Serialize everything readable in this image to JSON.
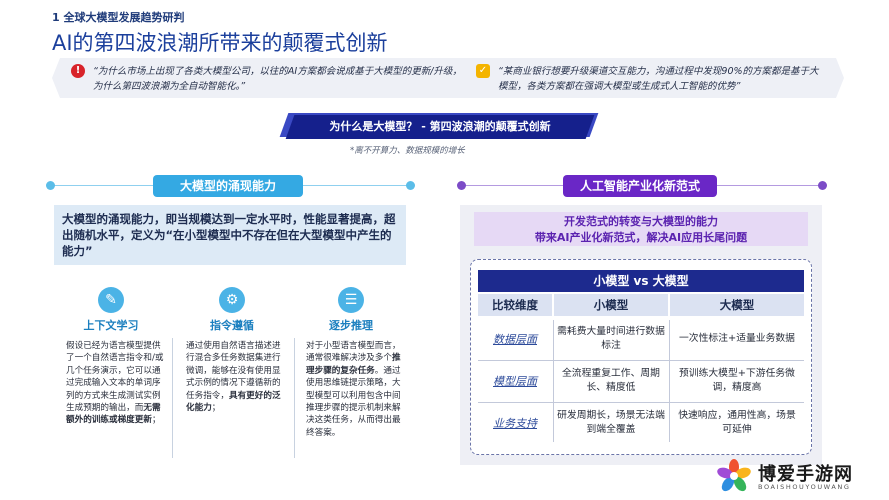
{
  "header": {
    "section_label": "1 全球大模型发展趋势研判",
    "title": "AI的第四波浪潮所带来的颠覆式创新"
  },
  "quotes": {
    "left": "“为什么市场上出现了各类大模型公司，以往的AI方案都会说成基于大模型的更新/升级，为什么第四波浪潮为全自动智能化。”",
    "right": "“某商业银行想要升级渠道交互能力，沟通过程中发现90%的方案都是基于大模型，各类方案都在强调大模型或生成式人工智能的优势”"
  },
  "banner": {
    "title": "为什么是大模型？ - 第四波浪潮的颠覆式创新",
    "note": "*离不开算力、数据规模的增长"
  },
  "left_section": {
    "pill": "大模型的涌现能力",
    "definition": "大模型的涌现能力，即当规模达到一定水平时，性能显著提高，超出随机水平，定义为“在小型模型中不存在但在大型模型中产生的能力”",
    "features": [
      {
        "icon": "edit-document-icon",
        "title": "上下文学习",
        "text_pre": "假设已经为语言模型提供了一个自然语言指令和/或几个任务演示，它可以通过完成输入文本的单词序列的方式来生成测试实例生成预期的输出，而",
        "text_bold": "无需额外的训练或梯度更新",
        "text_post": "；"
      },
      {
        "icon": "gear-brain-icon",
        "title": "指令遵循",
        "text_pre": "通过使用自然语言描述进行混合多任务数据集进行微调，能够在没有使用显式示例的情况下遵循新的任务指令，",
        "text_bold": "具有更好的泛化能力",
        "text_post": "；"
      },
      {
        "icon": "step-list-icon",
        "title": "逐步推理",
        "text_pre": "对于小型语言模型而言，通常很难解决涉及多个",
        "text_bold": "推理步骤的复杂任务",
        "text_post": "。通过使用思维链提示策略，大型模型可以利用包含中间推理步骤的提示机制来解决这类任务，从而得出最终答案。"
      }
    ]
  },
  "right_section": {
    "pill": "人工智能产业化新范式",
    "purple_line1": "开发范式的转变与大模型的能力",
    "purple_line2": "带来AI产业化新范式，解决AI应用长尾问题",
    "table": {
      "title": "小模型 vs 大模型",
      "headers": [
        "比较维度",
        "小模型",
        "大模型"
      ],
      "rows": [
        {
          "dimension": "数据层面",
          "small": "需耗费大量时间进行数据标注",
          "large": "一次性标注+适量业务数据"
        },
        {
          "dimension": "模型层面",
          "small": "全流程重复工作、周期长、精度低",
          "large": "预训练大模型+下游任务微调，精度高"
        },
        {
          "dimension": "业务支持",
          "small": "研发周期长，场景无法端到端全覆盖",
          "large": "快速响应，通用性高，场景可延伸"
        }
      ]
    }
  },
  "logo": {
    "cn": "博爱手游网",
    "en": "BOAISHOUYOUWANG"
  },
  "colors": {
    "title_blue": "#1b3f9c",
    "banner_navy": "#15208c",
    "left_accent": "#34a9e3",
    "right_accent": "#6a27c6",
    "quote_red": "#d8232a",
    "quote_yellow": "#f4b400"
  }
}
